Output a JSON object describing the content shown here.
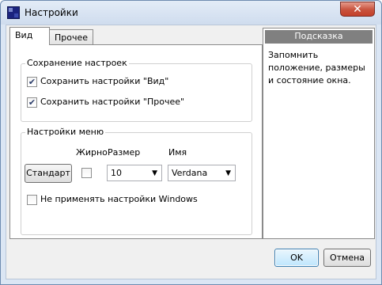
{
  "window": {
    "title": "Настройки",
    "close_glyph": "✕",
    "app_icon": "app-icon"
  },
  "tabs": [
    {
      "label": "Вид",
      "active": true
    },
    {
      "label": "Прочее",
      "active": false
    }
  ],
  "save_group": {
    "title": "Сохранение настроек",
    "items": [
      {
        "label": "Сохранить настройки \"Вид\"",
        "checked": true
      },
      {
        "label": "Сохранить настройки \"Прочее\"",
        "checked": true
      }
    ]
  },
  "menu_group": {
    "title": "Настройки меню",
    "bold_label": "Жирно",
    "size_label": "Размер",
    "name_label": "Имя",
    "standard_button": "Стандарт",
    "bold_checked": false,
    "size_value": "10",
    "font_value": "Verdana",
    "windows_settings_label": "Не применять настройки Windows",
    "windows_settings_checked": false
  },
  "hint": {
    "header": "Подсказка",
    "text": "Запомнить положение, размеры и состояние окна."
  },
  "footer": {
    "ok_label": "OK",
    "cancel_label": "Отмена"
  },
  "glyphs": {
    "check": "✔",
    "dropdown": "▼"
  }
}
